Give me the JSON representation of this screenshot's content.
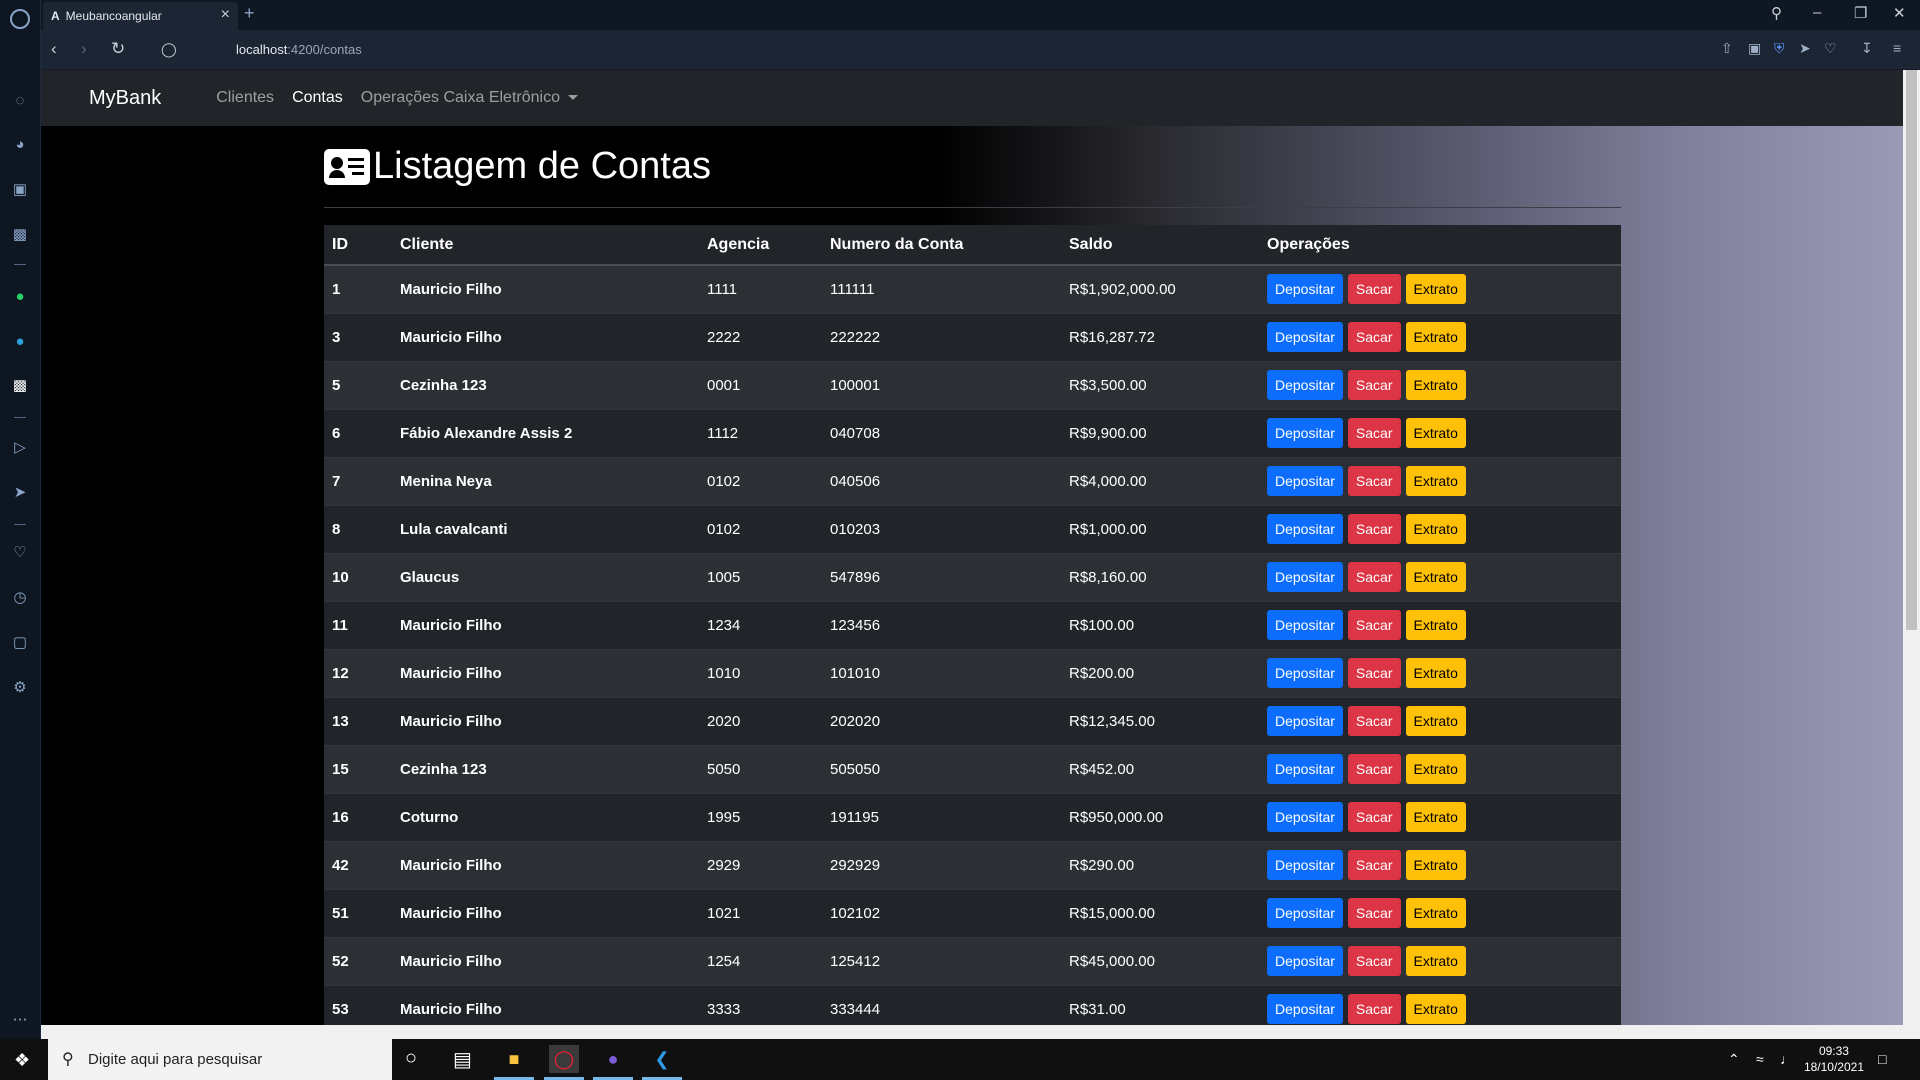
{
  "browser": {
    "tab_title": "Meubancoangular",
    "tab_favicon": "A",
    "url_host": "localhost",
    "url_path": ":4200/contas"
  },
  "navbar": {
    "brand": "MyBank",
    "links": [
      {
        "label": "Clientes"
      },
      {
        "label": "Contas"
      },
      {
        "label": "Operações Caixa Eletrônico"
      }
    ]
  },
  "page": {
    "title": "Listagem de Contas"
  },
  "table": {
    "headers": [
      "ID",
      "Cliente",
      "Agencia",
      "Numero da Conta",
      "Saldo",
      "Operações"
    ],
    "buttons": {
      "depositar": "Depositar",
      "sacar": "Sacar",
      "extrato": "Extrato"
    },
    "rows": [
      {
        "id": "1",
        "cliente": "Mauricio Filho",
        "agencia": "1111",
        "numero": "111111",
        "saldo": "R$1,902,000.00"
      },
      {
        "id": "3",
        "cliente": "Mauricio Filho",
        "agencia": "2222",
        "numero": "222222",
        "saldo": "R$16,287.72"
      },
      {
        "id": "5",
        "cliente": "Cezinha 123",
        "agencia": "0001",
        "numero": "100001",
        "saldo": "R$3,500.00"
      },
      {
        "id": "6",
        "cliente": "Fábio Alexandre Assis 2",
        "agencia": "1112",
        "numero": "040708",
        "saldo": "R$9,900.00"
      },
      {
        "id": "7",
        "cliente": "Menina Neya",
        "agencia": "0102",
        "numero": "040506",
        "saldo": "R$4,000.00"
      },
      {
        "id": "8",
        "cliente": "Lula cavalcanti",
        "agencia": "0102",
        "numero": "010203",
        "saldo": "R$1,000.00"
      },
      {
        "id": "10",
        "cliente": "Glaucus",
        "agencia": "1005",
        "numero": "547896",
        "saldo": "R$8,160.00"
      },
      {
        "id": "11",
        "cliente": "Mauricio Filho",
        "agencia": "1234",
        "numero": "123456",
        "saldo": "R$100.00"
      },
      {
        "id": "12",
        "cliente": "Mauricio Filho",
        "agencia": "1010",
        "numero": "101010",
        "saldo": "R$200.00"
      },
      {
        "id": "13",
        "cliente": "Mauricio Filho",
        "agencia": "2020",
        "numero": "202020",
        "saldo": "R$12,345.00"
      },
      {
        "id": "15",
        "cliente": "Cezinha 123",
        "agencia": "5050",
        "numero": "505050",
        "saldo": "R$452.00"
      },
      {
        "id": "16",
        "cliente": "Coturno",
        "agencia": "1995",
        "numero": "191195",
        "saldo": "R$950,000.00"
      },
      {
        "id": "42",
        "cliente": "Mauricio Filho",
        "agencia": "2929",
        "numero": "292929",
        "saldo": "R$290.00"
      },
      {
        "id": "51",
        "cliente": "Mauricio Filho",
        "agencia": "1021",
        "numero": "102102",
        "saldo": "R$15,000.00"
      },
      {
        "id": "52",
        "cliente": "Mauricio Filho",
        "agencia": "1254",
        "numero": "125412",
        "saldo": "R$45,000.00"
      },
      {
        "id": "53",
        "cliente": "Mauricio Filho",
        "agencia": "3333",
        "numero": "333444",
        "saldo": "R$31.00"
      }
    ]
  },
  "taskbar": {
    "search_placeholder": "Digite aqui para pesquisar",
    "time": "09:33",
    "date": "18/10/2021"
  },
  "colors": {
    "depositar": "#0d6efd",
    "sacar": "#dc3545",
    "extrato": "#ffc107",
    "navbar": "#212529"
  }
}
